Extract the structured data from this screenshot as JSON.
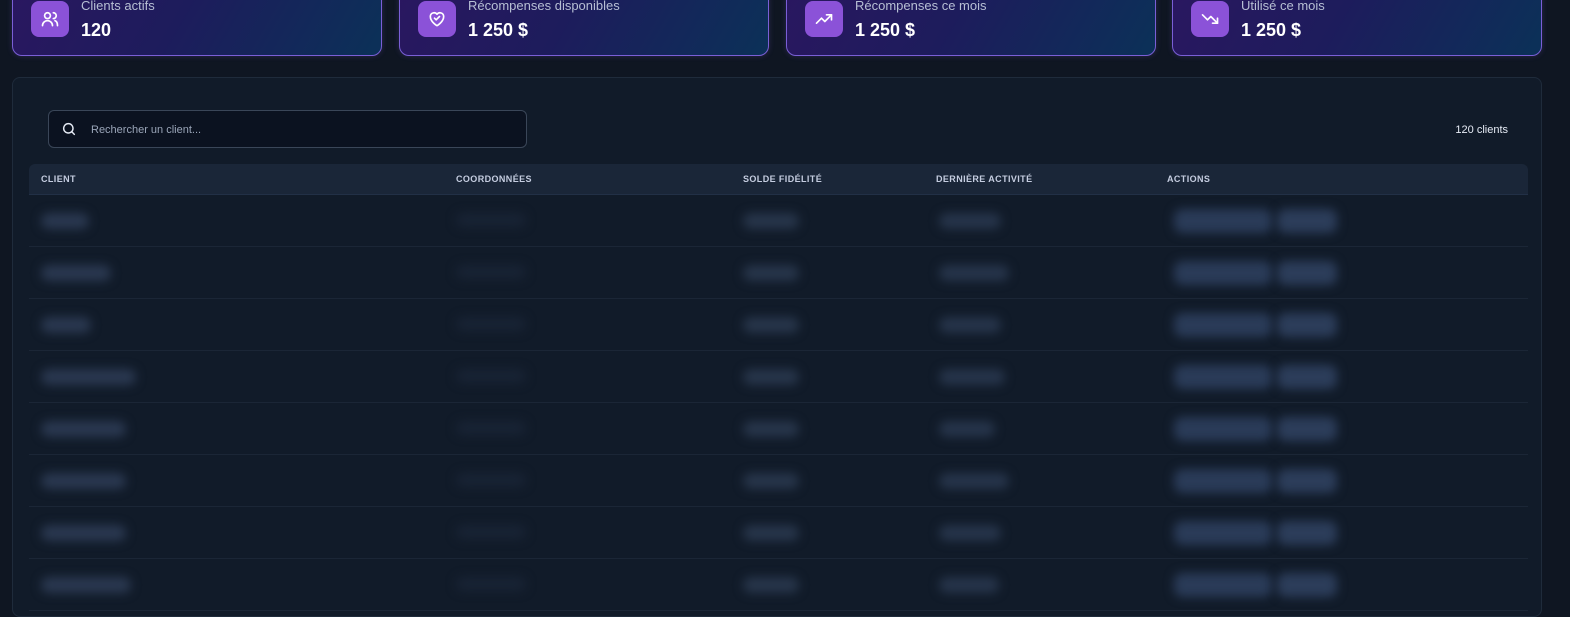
{
  "stats": [
    {
      "label": "Clients actifs",
      "value": "120",
      "icon": "users-icon"
    },
    {
      "label": "Récompenses disponibles",
      "value": "1 250 $",
      "icon": "heart-handshake-icon"
    },
    {
      "label": "Récompenses ce mois",
      "value": "1 250 $",
      "icon": "trending-up-icon"
    },
    {
      "label": "Utilisé ce mois",
      "value": "1 250 $",
      "icon": "trending-down-icon"
    }
  ],
  "search": {
    "placeholder": "Rechercher un client..."
  },
  "client_count": "120 clients",
  "table": {
    "headers": [
      "CLIENT",
      "COORDONNÉES",
      "SOLDE FIDÉLITÉ",
      "DERNIÈRE ACTIVITÉ",
      "ACTIONS"
    ],
    "rows_visible": 8
  },
  "colors": {
    "accent": "#8b52d8",
    "card_border": "#7a5fd6",
    "background": "#0f1622"
  }
}
